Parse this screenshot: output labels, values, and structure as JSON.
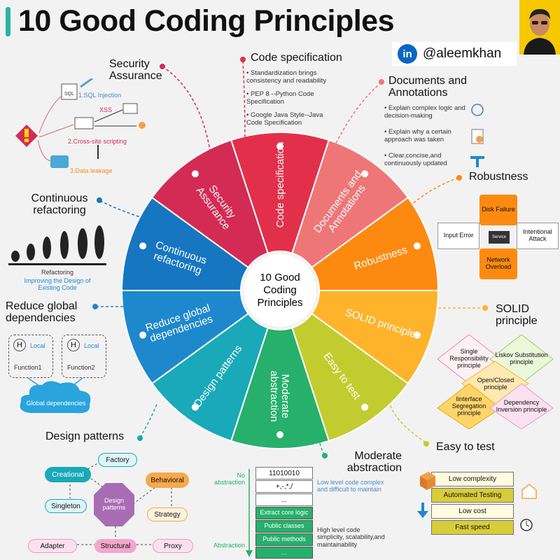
{
  "header": {
    "title": "10 Good Coding Principles",
    "linkedin_glyph": "in",
    "handle": "@aleemkhan"
  },
  "wheel": {
    "center_label": [
      "10 Good",
      "Coding",
      "Principles"
    ],
    "segments": [
      {
        "label": [
          "Code specification"
        ],
        "color": "#e2304a"
      },
      {
        "label": [
          "Documents and",
          "Annotations"
        ],
        "color": "#ef7677"
      },
      {
        "label": [
          "Robustness"
        ],
        "color": "#fd8a10"
      },
      {
        "label": [
          "SOLID principle"
        ],
        "color": "#ffb32a"
      },
      {
        "label": [
          "Easy to test"
        ],
        "color": "#c2cc2e"
      },
      {
        "label": [
          "Moderate",
          "abstraction"
        ],
        "color": "#27b06b"
      },
      {
        "label": [
          "Design patterns"
        ],
        "color": "#19a9b8"
      },
      {
        "label": [
          "Reduce global",
          "dependencies"
        ],
        "color": "#1e88cc"
      },
      {
        "label": [
          "Continuous",
          "refactoring"
        ],
        "color": "#1776c0"
      },
      {
        "label": [
          "Security",
          "Assurance"
        ],
        "color": "#d42b55"
      }
    ]
  },
  "sections": {
    "security": {
      "title": "Security Assurance",
      "items": [
        "1.SQL Injection",
        "XSS",
        "2.Cross-site scripting",
        "3.Data leakage",
        "SQL"
      ]
    },
    "code_spec": {
      "title": "Code specification",
      "bullets": [
        "Standardization brings consistency and readability",
        "PEP 8 --Python Code Specification",
        "Google Java Style--Java Code Specification"
      ]
    },
    "documents": {
      "title": "Documents and Annotations",
      "bullets": [
        "Explain complex logic and decision-making",
        "Explain why a certain approach was taken",
        "Clear,concise,and continuously updated"
      ]
    },
    "robustness": {
      "title": "Robustness",
      "boxes": [
        "Disk Failure",
        "Input Error",
        "Intentional Attack",
        "Network Overload"
      ],
      "center": "Service"
    },
    "solid": {
      "title": "SOLID principle",
      "diamonds": [
        "Single Responsibility principle",
        "Liskov Substitution principle",
        "Open/Closed principle",
        "Iinterface Segregation principle",
        "Dependency Inversion principle"
      ]
    },
    "easy_test": {
      "title": "Easy to test",
      "rows": [
        "Low complexity",
        "Automated Testing",
        "Low cost",
        "Fast speed"
      ]
    },
    "abstraction": {
      "title": "Moderate abstraction",
      "axis_top": "No abstraction",
      "axis_bottom": "Abstraction",
      "rows": [
        "11010010",
        "+,-,*,/",
        "...",
        "Extract core logic",
        "Public classes",
        "Public methods",
        "..."
      ],
      "note_low": "Low level code complex and difficult to maintain",
      "note_high": "High level code simplicity, scalability,and maintainability"
    },
    "design_patterns": {
      "title": "Design patterns",
      "center": "Design patterns",
      "nodes": [
        "Factory",
        "Creational",
        "Singleton",
        "Behavioral",
        "Strategy",
        "Adapter",
        "Structural",
        "Proxy"
      ]
    },
    "global_deps": {
      "title": "Reduce global dependencies",
      "h": "H",
      "local": "Local",
      "f1": "Function1",
      "f2": "Function2",
      "global": "Global dependencies"
    },
    "refactoring": {
      "title": "Continuous refactoring",
      "caption": "Refactoring",
      "subcaption": "Improving the Design of Existing Code"
    }
  }
}
